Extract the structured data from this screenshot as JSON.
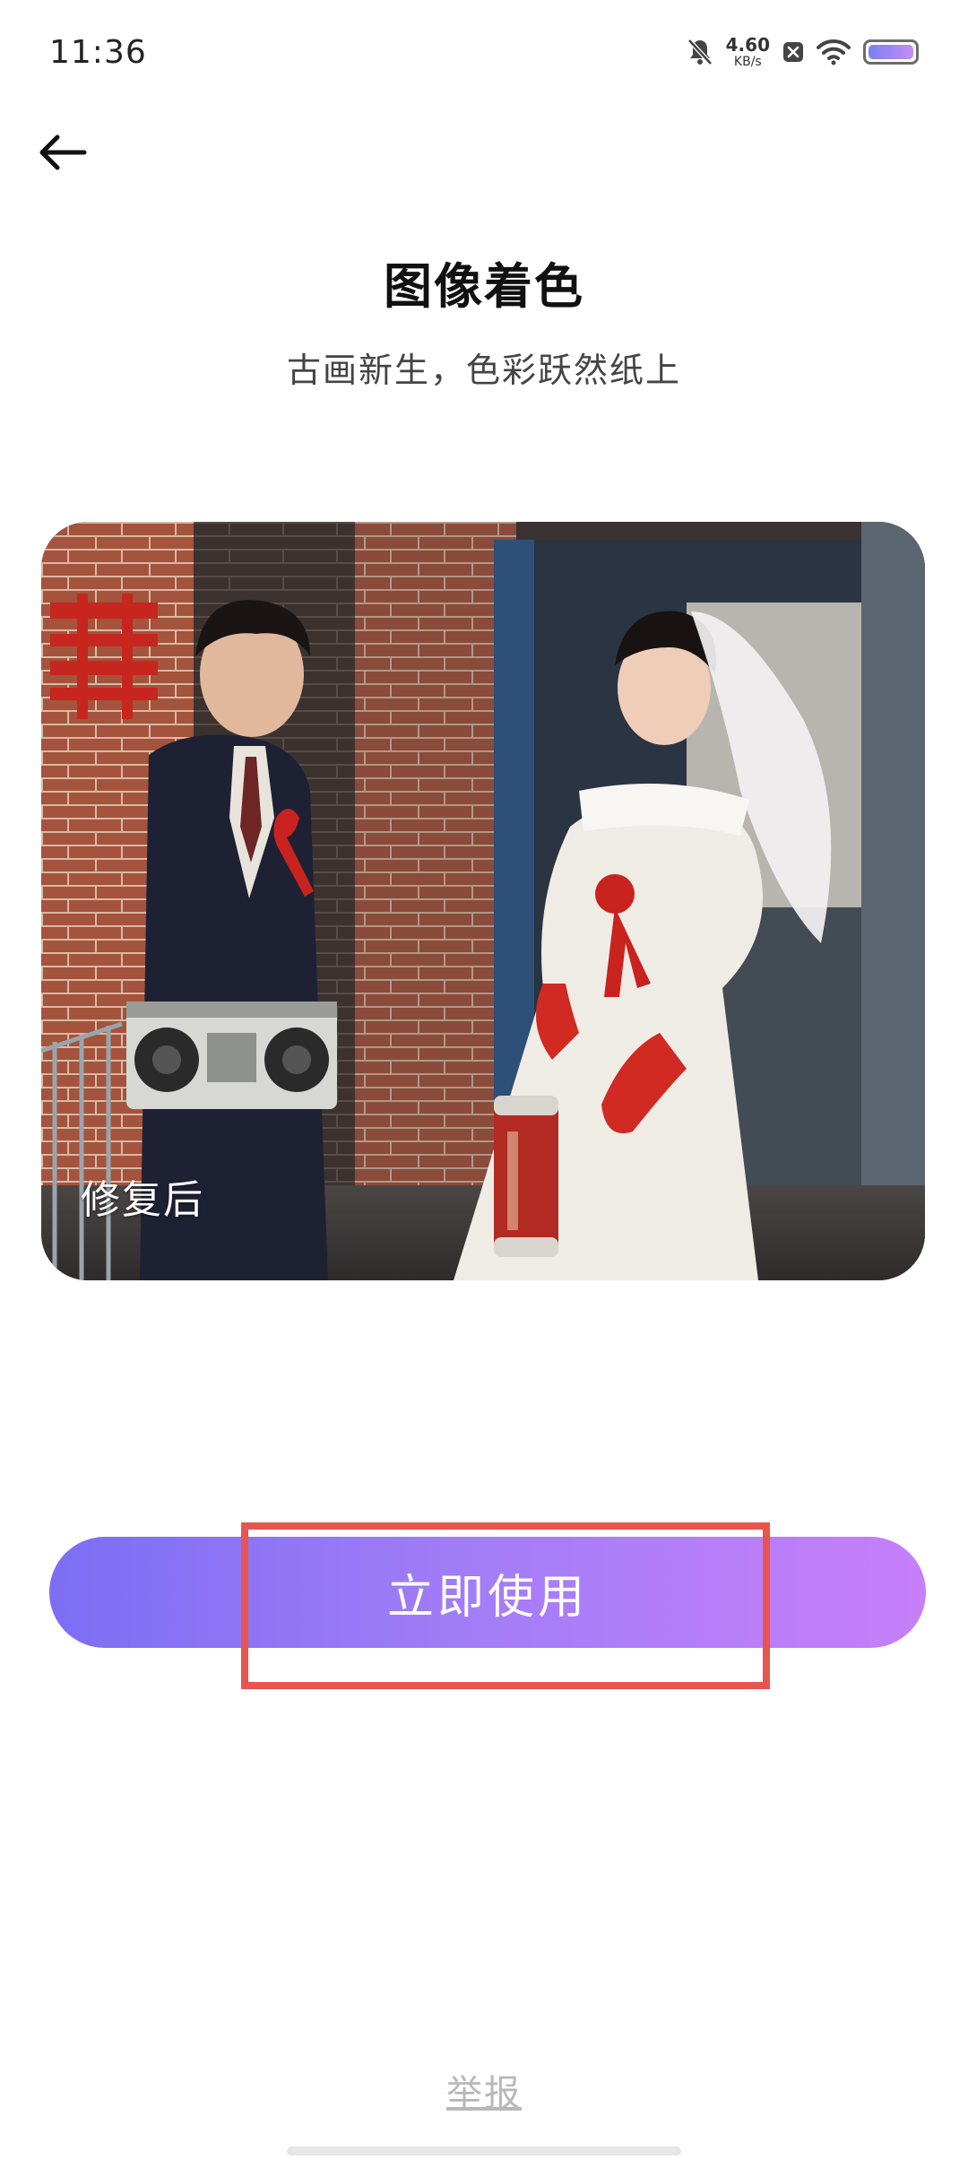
{
  "status_bar": {
    "time": "11:36",
    "net_speed": "4.60",
    "net_unit": "KB/s",
    "icons": [
      "bell-off-icon",
      "close-badge-icon",
      "wifi-icon",
      "battery-icon"
    ],
    "battery_level": 1.0
  },
  "header": {
    "back_icon": "back-arrow-icon",
    "title": "图像着色",
    "subtitle": "古画新生，色彩跃然纸上"
  },
  "preview": {
    "label": "修复后"
  },
  "cta": {
    "label": "立即使用",
    "gradient_start": "#7c6ef4",
    "gradient_end": "#c77ef9"
  },
  "highlight": {
    "color": "#e8544f"
  },
  "footer": {
    "report_label": "举报"
  }
}
